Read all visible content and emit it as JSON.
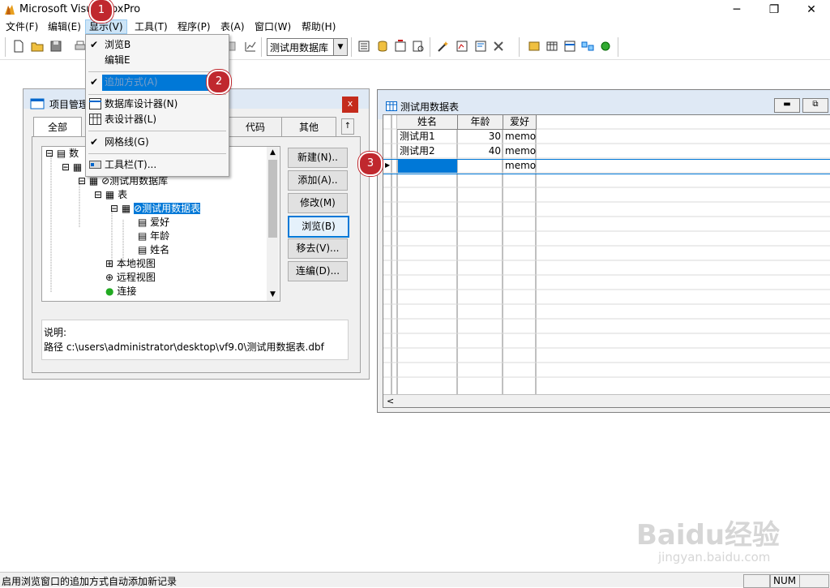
{
  "window": {
    "title": "Microsoft Visual FoxPro",
    "minimize": "─",
    "maximize": "❐",
    "close": "✕"
  },
  "menubar": {
    "items": [
      {
        "label": "文件(F)"
      },
      {
        "label": "编辑(E)"
      },
      {
        "label": "显示(V)"
      },
      {
        "label": "工具(T)"
      },
      {
        "label": "程序(P)"
      },
      {
        "label": "表(A)"
      },
      {
        "label": "窗口(W)"
      },
      {
        "label": "帮助(H)"
      }
    ]
  },
  "toolbar": {
    "database_combo": "测试用数据库"
  },
  "view_menu": {
    "items": [
      {
        "label": "浏览B",
        "checked": true
      },
      {
        "label": "编辑E",
        "checked": false
      },
      {
        "label": "追加方式(A)",
        "checked": true,
        "highlighted": true
      },
      {
        "label": "数据库设计器(N)",
        "icon": "database-designer-icon"
      },
      {
        "label": "表设计器(L)",
        "icon": "table-designer-icon"
      },
      {
        "label": "网格线(G)",
        "checked": true
      },
      {
        "label": "工具栏(T)...",
        "icon": "toolbar-icon"
      }
    ]
  },
  "project_manager": {
    "title": "项目管理器",
    "tabs": [
      {
        "label": "全部"
      },
      {
        "label": "代码"
      },
      {
        "label": "其他"
      }
    ],
    "tab_scroll": "↑",
    "tree": [
      {
        "label": "数"
      },
      {
        "label": "⊘测试用数据库"
      },
      {
        "label": "表"
      },
      {
        "label": "⊘测试用数据表"
      },
      {
        "label": "爱好"
      },
      {
        "label": "年龄"
      },
      {
        "label": "姓名"
      },
      {
        "label": "本地视图"
      },
      {
        "label": "远程视图"
      },
      {
        "label": "连接"
      }
    ],
    "buttons": [
      {
        "label": "新建(N).."
      },
      {
        "label": "添加(A).."
      },
      {
        "label": "修改(M)"
      },
      {
        "label": "浏览(B)"
      },
      {
        "label": "移去(V)..."
      },
      {
        "label": "连编(D)..."
      }
    ],
    "description_label": "说明:",
    "path_text": "路径 c:\\users\\administrator\\desktop\\vf9.0\\测试用数据表.dbf"
  },
  "browse_window": {
    "title": "测试用数据表",
    "columns": [
      "姓名",
      "年龄",
      "爱好"
    ],
    "rows": [
      {
        "name": "测试用1",
        "age": "30",
        "hobby": "memo"
      },
      {
        "name": "测试用2",
        "age": "40",
        "hobby": "memo"
      },
      {
        "name": "",
        "age": "",
        "hobby": "memo"
      }
    ],
    "scroll_left": "<"
  },
  "badges": [
    "1",
    "2",
    "3"
  ],
  "statusbar": {
    "message": "启用浏览窗口的追加方式自动添加新记录",
    "num": "NUM"
  },
  "watermark": {
    "main": "Baidu经验",
    "sub": "jingyan.baidu.com"
  },
  "colors": {
    "highlight": "#0078d7",
    "badge": "#c0282e",
    "close_red": "#c42b1c"
  }
}
